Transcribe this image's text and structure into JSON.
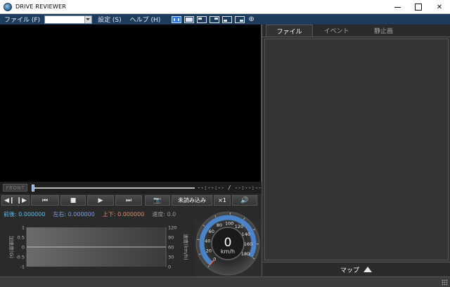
{
  "window": {
    "title": "DRIVE REVIEWER",
    "close_glyph": "✕"
  },
  "menu": {
    "file": "ファイル (F)",
    "file_combo_value": "",
    "settings": "設定 (S)",
    "help": "ヘルプ (H)"
  },
  "layout_icons": [
    "layout-full-icon",
    "layout-1-icon",
    "layout-2-icon",
    "layout-3-icon",
    "layout-4-icon",
    "zoom-icon"
  ],
  "seek": {
    "camera_label": "FRONT",
    "time": "--:--:-- / --:--:--",
    "progress": 0
  },
  "controls": {
    "frame_step": "◀❙ ❙▶",
    "prev": "⏮",
    "stop": "■",
    "play": "▶",
    "next": "⏭",
    "unread": "未読み込み",
    "rate": "×1",
    "capture_glyph": "📷",
    "volume_glyph": "🔊"
  },
  "sensors": {
    "front_back": "前後: 0.000000",
    "left_right": "左右: 0.000000",
    "up_down": "上下: 0.000000",
    "speed": "速度: 0.0"
  },
  "graph": {
    "left_axis_label": "加速度(G)",
    "left_ticks": [
      "1",
      "0.5",
      "0",
      "-0.5",
      "-1"
    ],
    "right_axis_label": "速度(km/h)",
    "right_ticks": [
      "120",
      "90",
      "60",
      "30",
      "0"
    ]
  },
  "speedometer": {
    "value": "0",
    "unit": "km/h",
    "ticks": [
      "0",
      "20",
      "40",
      "60",
      "80",
      "100",
      "120",
      "140",
      "160",
      "180"
    ],
    "max": 180,
    "current": 0
  },
  "right_panel": {
    "tabs": [
      "ファイル",
      "イベント",
      "静止画"
    ],
    "active_tab": 0,
    "map_label": "マップ"
  },
  "colors": {
    "menubar": "#1d3c5c",
    "accent": "#2f7ad6",
    "front_back": "#5fbfe8",
    "left_right": "#7f9ee8",
    "up_down": "#e88a6a"
  }
}
